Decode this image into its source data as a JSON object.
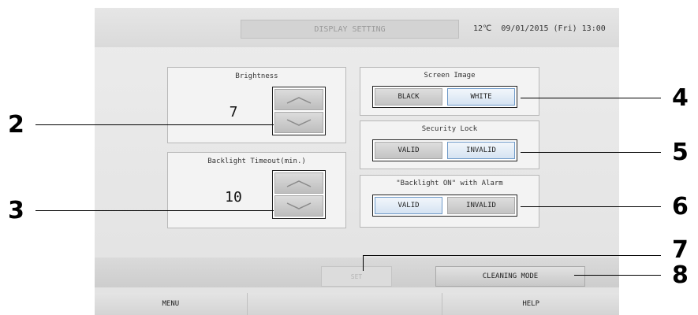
{
  "header": {
    "title": "DISPLAY SETTING",
    "status": "12℃  09/01/2015 (Fri) 13:00"
  },
  "brightness": {
    "title": "Brightness",
    "value": "7",
    "up_icon": "chevron-up-icon",
    "down_icon": "chevron-down-icon"
  },
  "backlight_timeout": {
    "title": "Backlight Timeout(min.)",
    "value": "10",
    "up_icon": "chevron-up-icon",
    "down_icon": "chevron-down-icon"
  },
  "screen_image": {
    "title": "Screen Image",
    "options": [
      "BLACK",
      "WHITE"
    ],
    "selected": "WHITE"
  },
  "security_lock": {
    "title": "Security Lock",
    "options": [
      "VALID",
      "INVALID"
    ],
    "selected": "INVALID"
  },
  "backlight_alarm": {
    "title": "\"Backlight ON\" with Alarm",
    "options": [
      "VALID",
      "INVALID"
    ],
    "selected": "VALID"
  },
  "actions": {
    "set_label": "SET",
    "cleaning_label": "CLEANING MODE"
  },
  "footer": {
    "menu_label": "MENU",
    "middle_label": "",
    "help_label": "HELP"
  },
  "callouts": [
    "2",
    "3",
    "4",
    "5",
    "6",
    "7",
    "8"
  ],
  "colors": {
    "selected_border": "#6f9ac8",
    "screen_bg": "#e6e6e6",
    "callout": "#000000"
  }
}
